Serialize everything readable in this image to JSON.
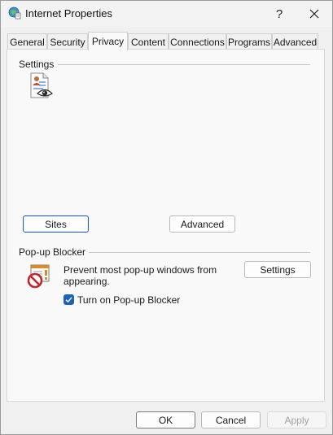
{
  "window": {
    "title": "Internet Properties"
  },
  "titlebar": {
    "help": "?",
    "close_icon": "close-icon"
  },
  "tabs": [
    {
      "label": "General"
    },
    {
      "label": "Security"
    },
    {
      "label": "Privacy",
      "active": true
    },
    {
      "label": "Content"
    },
    {
      "label": "Connections"
    },
    {
      "label": "Programs"
    },
    {
      "label": "Advanced"
    }
  ],
  "settings_group": {
    "label": "Settings",
    "icon": "privacy-document-eye-icon",
    "sites_button": "Sites",
    "advanced_button": "Advanced"
  },
  "popup_group": {
    "label": "Pop-up Blocker",
    "icon": "popup-blocker-icon",
    "description": "Prevent most pop-up windows from appearing.",
    "settings_button": "Settings",
    "checkbox_label": "Turn on Pop-up Blocker",
    "checkbox_checked": true
  },
  "footer": {
    "ok": "OK",
    "cancel": "Cancel",
    "apply": "Apply"
  },
  "colors": {
    "accent": "#1a63b8",
    "window_bg": "#f0f0f0",
    "panel_bg": "#f9f9f9"
  }
}
